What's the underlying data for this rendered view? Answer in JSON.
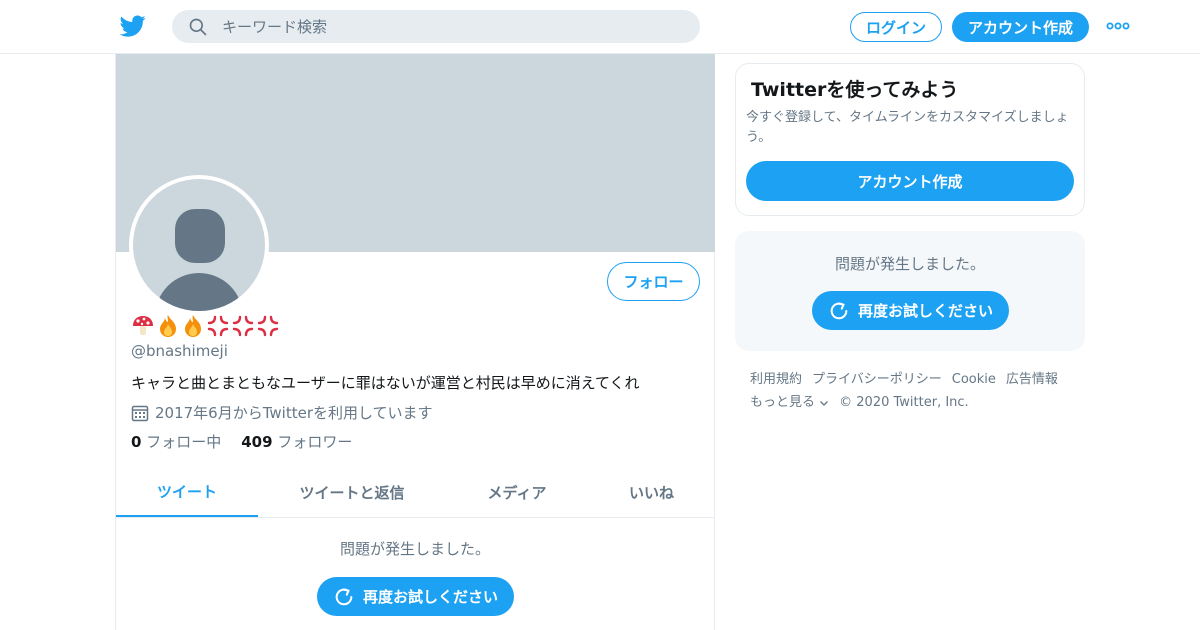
{
  "header": {
    "search_placeholder": "キーワード検索",
    "login_label": "ログイン",
    "signup_label": "アカウント作成",
    "brand_color": "#1da1f2"
  },
  "profile": {
    "name_emoji": [
      "mushroom",
      "fire",
      "fire",
      "anger",
      "anger",
      "anger"
    ],
    "handle": "@bnashimeji",
    "bio": "キャラと曲とまともなユーザーに罪はないが運営と村民は早めに消えてくれ",
    "joined": "2017年6月からTwitterを利用しています",
    "following_count": "0",
    "following_label": "フォロー中",
    "followers_count": "409",
    "followers_label": "フォロワー",
    "follow_label": "フォロー"
  },
  "tabs": [
    {
      "label": "ツイート",
      "active": true
    },
    {
      "label": "ツイートと返信",
      "active": false
    },
    {
      "label": "メディア",
      "active": false
    },
    {
      "label": "いいね",
      "active": false
    }
  ],
  "timeline": {
    "error_text": "問題が発生しました。",
    "retry_label": "再度お試しください"
  },
  "sidebar": {
    "signup_card": {
      "title": "Twitterを使ってみよう",
      "description": "今すぐ登録して、タイムラインをカスタマイズしましょう。",
      "button_label": "アカウント作成"
    },
    "error_card": {
      "error_text": "問題が発生しました。",
      "retry_label": "再度お試しください"
    },
    "footer": {
      "links": [
        "利用規約",
        "プライバシーポリシー",
        "Cookie",
        "広告情報"
      ],
      "more_label": "もっと見る",
      "copyright": "© 2020 Twitter, Inc."
    }
  }
}
